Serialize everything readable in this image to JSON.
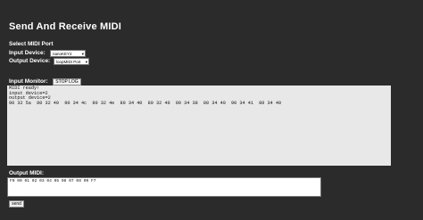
{
  "header": {
    "title": "Send And Receive MIDI"
  },
  "port_select": {
    "section_label": "Select MIDI Port",
    "input_label": "Input Device:",
    "input_value": "nanoKEY2",
    "output_label": "Output Device:",
    "output_value": "loopMIDI Port"
  },
  "monitor": {
    "label": "Input Monitor:",
    "stop_button": "STOP LOG",
    "lines": [
      "MIDI ready!",
      "input device=2",
      "output device=2",
      "90 32 5a  80 32 40  90 34 4c  90 32 4e  80 34 40  80 32 40  90 34 38  80 34 40  90 34 41  80 34 40"
    ]
  },
  "output": {
    "label": "Output MIDI:",
    "value": "F0 00 01 02 03 04 05 06 07 08 09 F7",
    "send_button": "send"
  },
  "colors": {
    "background": "#2b2b2b",
    "text": "#ffffff",
    "log_background": "#e8e8e8"
  }
}
